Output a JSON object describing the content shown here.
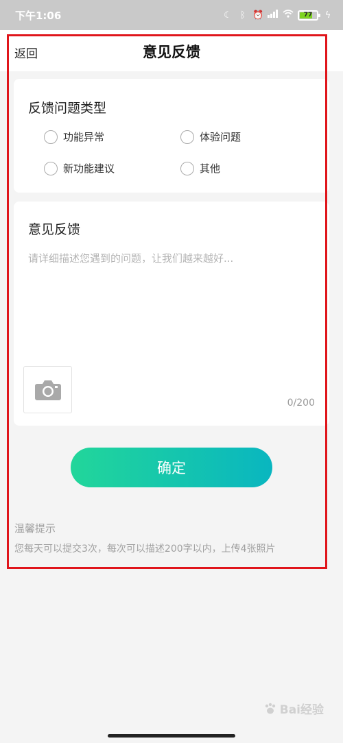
{
  "status_bar": {
    "time": "下午1:06",
    "icons": [
      "moon-icon",
      "bluetooth-icon",
      "alarm-icon",
      "signal-icon",
      "wifi-icon"
    ],
    "battery_level": "77",
    "battery_fill": 0.77,
    "battery_color": "#7ed321"
  },
  "nav": {
    "back_label": "返回",
    "title": "意见反馈"
  },
  "type_section": {
    "title": "反馈问题类型",
    "options": [
      {
        "label": "功能异常",
        "selected": false
      },
      {
        "label": "体验问题",
        "selected": false
      },
      {
        "label": "新功能建议",
        "selected": false
      },
      {
        "label": "其他",
        "selected": false
      }
    ]
  },
  "feedback_section": {
    "title": "意见反馈",
    "placeholder": "请详细描述您遇到的问题，让我们越来越好...",
    "value": "",
    "char_count": "0/200"
  },
  "confirm_label": "确定",
  "tips": {
    "title": "温馨提示",
    "text": "您每天可以提交3次，每次可以描述200字以内，上传4张照片"
  },
  "watermark": "Bai经验",
  "colors": {
    "accent_start": "#22d69a",
    "accent_end": "#09b6c0",
    "highlight": "#e0151b"
  }
}
